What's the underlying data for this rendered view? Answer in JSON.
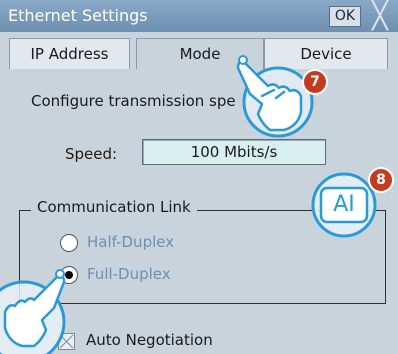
{
  "window": {
    "title": "Ethernet Settings",
    "ok_label": "OK",
    "close_glyph": "╳"
  },
  "tabs": [
    {
      "label": "IP Address",
      "active": false
    },
    {
      "label": "Mode",
      "active": true
    },
    {
      "label": "Device",
      "active": false
    }
  ],
  "mode": {
    "description": "Configure transmission spe",
    "speed_label": "Speed:",
    "speed_value": "100 Mbits/s"
  },
  "communication_link": {
    "legend": "Communication Link",
    "options": [
      {
        "label": "Half-Duplex",
        "selected": false
      },
      {
        "label": "Full-Duplex",
        "selected": true
      }
    ]
  },
  "auto_negotiation": {
    "label": "Auto Negotiation",
    "checked": false
  },
  "callouts": [
    {
      "number": "7",
      "icon": "tap-hand-icon"
    },
    {
      "number": "8",
      "icon": "keyboard-input-icon",
      "icon_text": "AI"
    }
  ],
  "colors": {
    "titlebar": "#7b9bbb",
    "panel": "#c9d3dc",
    "field": "#d9eeee",
    "callout_ring": "#2a9ad6",
    "badge": "#c63a1e",
    "radio_label": "#6d8fb4"
  }
}
